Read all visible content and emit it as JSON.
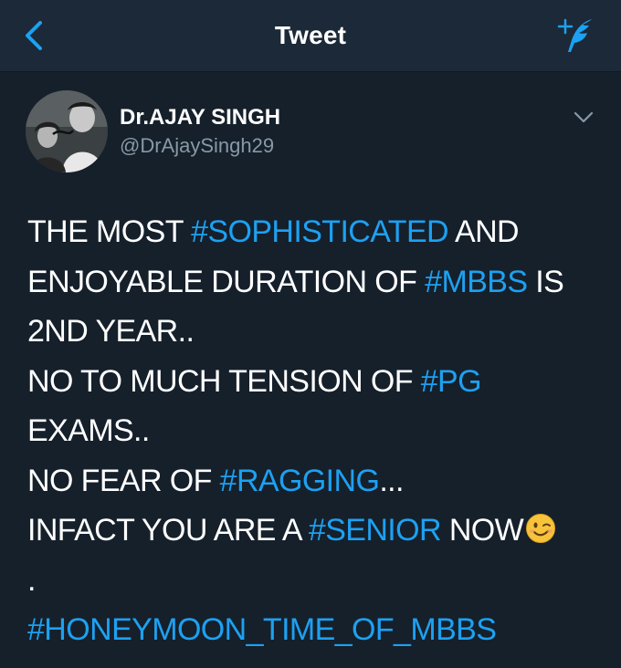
{
  "nav": {
    "title": "Tweet",
    "back_icon": "chevron-left-icon",
    "compose_icon": "compose-feather-icon"
  },
  "tweet": {
    "author": {
      "display_name": "Dr.AJAY SINGH",
      "handle": "@DrAjaySingh29"
    },
    "menu_icon": "chevron-down-icon",
    "body": {
      "l1_a": "THE MOST ",
      "l1_tag": "#SOPHISTICATED",
      "l1_b": " AND",
      "l2_a": "ENJOYABLE DURATION OF ",
      "l2_tag": "#MBBS",
      "l2_b": " IS",
      "l3": "2ND YEAR..",
      "l4_a": "NO TO MUCH TENSION OF ",
      "l4_tag": "#PG",
      "l5": "EXAMS..",
      "l6_a": "NO FEAR OF ",
      "l6_tag": "#RAGGING",
      "l6_b": "...",
      "l7_a": "INFACT YOU ARE A ",
      "l7_tag": "#SENIOR",
      "l7_b": " NOW",
      "l7_emoji": "winking-face-emoji",
      "l8": ".",
      "l9_tag": "#HONEYMOON_TIME_OF_MBBS"
    }
  },
  "colors": {
    "background": "#15202b",
    "nav_bar": "#1c2938",
    "accent": "#1da1f2",
    "secondary_text": "#8899a6"
  }
}
